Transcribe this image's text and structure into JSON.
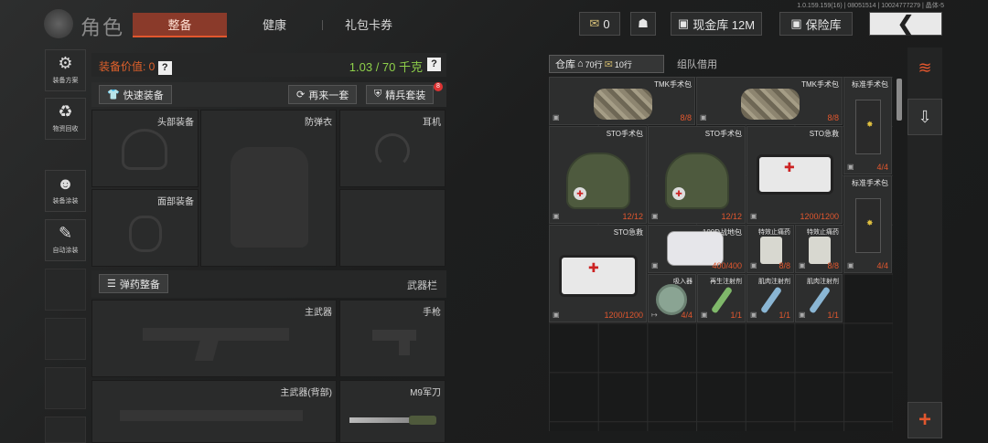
{
  "header": {
    "build": "1.0.159.159(16) | 08051514 | 10024777279 | 晶体-5",
    "title": "角色",
    "tabs": [
      "整备",
      "健康",
      "礼包卡券"
    ],
    "coupon_count": "0",
    "cash_label": "现金库 12M",
    "insurance_label": "保险库",
    "back_glyph": "❮"
  },
  "sidebar": {
    "items": [
      {
        "label": "装备方案",
        "icon": "gear-loadout-icon"
      },
      {
        "label": "物资回收",
        "icon": "recycle-icon"
      },
      {
        "label": "装备涂装",
        "icon": "paint-icon"
      },
      {
        "label": "自动涂装",
        "icon": "auto-paint-icon"
      }
    ]
  },
  "equipment": {
    "value_label": "装备价值: 0",
    "weight": "1.03 / 70 千克",
    "quick_equip": "快速装备",
    "again": "再来一套",
    "elite": "精兵套装",
    "elite_badge": "8",
    "slots": {
      "head": "头部装备",
      "armor": "防弹衣",
      "headset": "耳机",
      "face": "面部装备",
      "ammo": "弹药整备",
      "weapon_bar": "武器栏",
      "primary": "主武器",
      "pistol": "手枪",
      "primary_back": "主武器(背部)",
      "knife": "M9军刀"
    }
  },
  "warehouse": {
    "tab_label": "仓库",
    "rows": "70行",
    "rows2": "10行",
    "team_loan": "组队借用",
    "items": [
      {
        "name": "TMK手术包",
        "count": "8/8"
      },
      {
        "name": "TMK手术包",
        "count": "8/8"
      },
      {
        "name": "标准手术包",
        "count": "4/4"
      },
      {
        "name": "STO手术包",
        "count": "12/12"
      },
      {
        "name": "STO手术包",
        "count": "12/12"
      },
      {
        "name": "STO急救",
        "count": "1200/1200"
      },
      {
        "name": "标准手术包",
        "count": "4/4"
      },
      {
        "name": "STO急救",
        "count": "1200/1200"
      },
      {
        "name": "100D战地包",
        "count": "400/400"
      },
      {
        "name": "特效止痛药",
        "count": "8/8"
      },
      {
        "name": "特效止痛药",
        "count": "8/8"
      },
      {
        "name": "吸入器",
        "count": "4/4"
      },
      {
        "name": "再生注射剂",
        "count": "1/1"
      },
      {
        "name": "肌肉注射剂",
        "count": "1/1"
      },
      {
        "name": "肌肉注射剂",
        "count": "1/1"
      }
    ]
  }
}
